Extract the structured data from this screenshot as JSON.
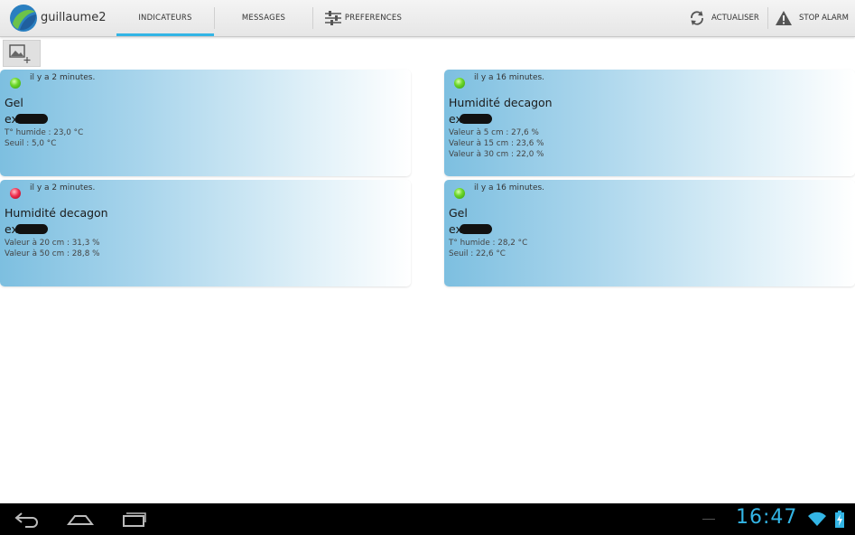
{
  "app": {
    "title": "guillaume2"
  },
  "tabs": [
    {
      "label": "INDICATEURS",
      "selected": true
    },
    {
      "label": "MESSAGES"
    },
    {
      "label": "PREFERENCES",
      "icon": "sliders-icon"
    }
  ],
  "actions": {
    "refresh": {
      "label": "ACTUALISER",
      "icon": "refresh-icon"
    },
    "stop": {
      "label": "STOP ALARM",
      "icon": "warning-icon"
    }
  },
  "toolbar": {
    "add_image_icon": "add-image-icon"
  },
  "cards": [
    {
      "status": "green",
      "time": "il y a 2 minutes.",
      "title": "Gel",
      "id_prefix": "ex",
      "lines": [
        "T° humide : 23,0 °C",
        "Seuil : 5,0 °C"
      ]
    },
    {
      "status": "green",
      "time": "il y a 16 minutes.",
      "title": "Humidité decagon",
      "id_prefix": "ex",
      "lines": [
        "Valeur à  5 cm : 27,6 %",
        "Valeur à  15 cm : 23,6 %",
        "Valeur à  30 cm : 22,0 %"
      ]
    },
    {
      "status": "red",
      "time": "il y a 2 minutes.",
      "title": "Humidité decagon",
      "id_prefix": "ex",
      "lines": [
        "Valeur à  20 cm : 31,3 %",
        "Valeur à  50 cm : 28,8 %"
      ]
    },
    {
      "status": "green",
      "time": "il y a 16 minutes.",
      "title": "Gel",
      "id_prefix": "ex",
      "lines": [
        "T° humide : 28,2 °C",
        "Seuil : 22,6 °C"
      ]
    }
  ],
  "status_colors": {
    "green": "#4cc61c",
    "red": "#e0203c",
    "accent": "#33b5e5"
  },
  "system_bar": {
    "clock": "16:47"
  }
}
